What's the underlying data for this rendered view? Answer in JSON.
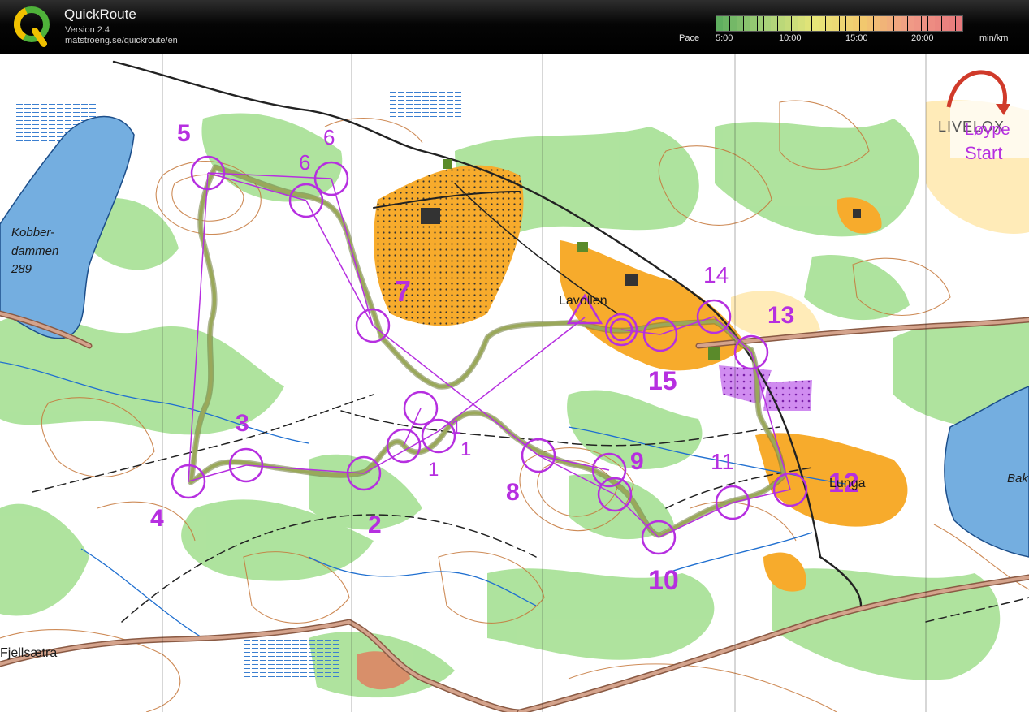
{
  "app": {
    "name": "QuickRoute",
    "version": "Version 2.4",
    "url": "matstroeng.se/quickroute/en"
  },
  "pace_scale": {
    "label": "Pace",
    "unit": "min/km",
    "ticks": [
      "5:00",
      "10:00",
      "15:00",
      "20:00"
    ],
    "gradient_colors": [
      "#5fae5f",
      "#a9d27a",
      "#e8e678",
      "#f2c86e",
      "#f09a86",
      "#e8797c"
    ]
  },
  "map": {
    "place_names": {
      "lake_west": [
        "Kobber-",
        "dammen",
        "289"
      ],
      "village_center": "Lavollen",
      "village_east": "Lunga",
      "lake_east": "Bak",
      "southwest": "Fjellsætra"
    },
    "watermark": {
      "brand": "LIVELOX",
      "course": "Løype",
      "start": "Start"
    },
    "controls": [
      {
        "label": "1",
        "label2": "1"
      },
      {
        "label": "2"
      },
      {
        "label": "3"
      },
      {
        "label": "4"
      },
      {
        "label": "5"
      },
      {
        "label": "6",
        "label2": "6"
      },
      {
        "label": "7"
      },
      {
        "label": "8"
      },
      {
        "label": "9"
      },
      {
        "label": "10"
      },
      {
        "label": "11"
      },
      {
        "label": "12"
      },
      {
        "label": "13"
      },
      {
        "label": "14"
      },
      {
        "label": "15"
      }
    ],
    "colors": {
      "course": "#b62fe0",
      "route": "#8a9e55",
      "forest": "#ffffff",
      "vegetation": "#9fdc8c",
      "open_land": "#f7ab2c",
      "water": "#74aee0",
      "contour": "#c5773a",
      "road": "#bf7f6a"
    }
  }
}
